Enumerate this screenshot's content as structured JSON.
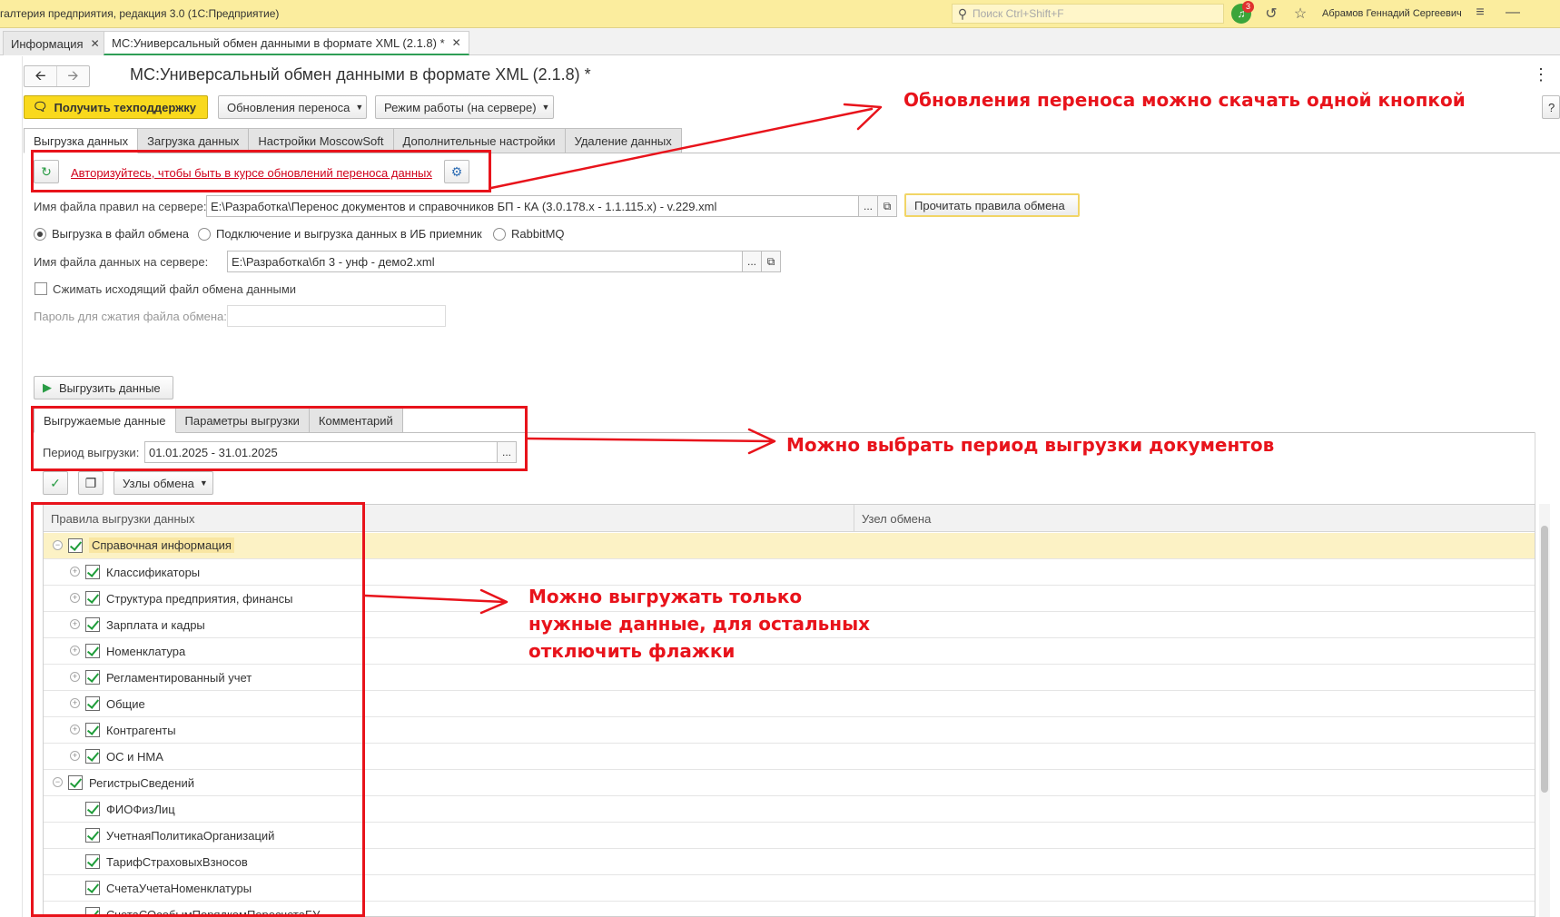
{
  "titlebar": {
    "app_title": "галтерия предприятия, редакция 3.0  (1С:Предприятие)",
    "search_placeholder": "Поиск Ctrl+Shift+F",
    "notifications_count": "3",
    "user_name": "Абрамов Геннадий Сергеевич"
  },
  "open_tabs": [
    {
      "label": "Информация"
    },
    {
      "label": "МС:Универсальный обмен данными в формате XML (2.1.8) *"
    }
  ],
  "form": {
    "title": "МС:Универсальный обмен данными в формате XML (2.1.8) *",
    "support_button": "Получить техподдержку",
    "updates_button": "Обновления переноса",
    "mode_button": "Режим работы (на сервере)",
    "help_button": "?",
    "tabs": [
      "Выгрузка данных",
      "Загрузка данных",
      "Настройки MoscowSoft",
      "Дополнительные настройки",
      "Удаление данных"
    ],
    "auth_link": "Авторизуйтесь, чтобы быть в курсе обновлений переноса данных",
    "rules_file_label": "Имя файла правил на сервере:",
    "rules_file_value": "E:\\Разработка\\Перенос документов и справочников БП - КА (3.0.178.x - 1.1.115.x) - v.229.xml",
    "read_rules_button": "Прочитать правила обмена",
    "radio_options": [
      "Выгрузка в файл обмена",
      "Подключение и выгрузка данных в ИБ приемник",
      "RabbitMQ"
    ],
    "data_file_label": "Имя файла данных на сервере:",
    "data_file_value": "E:\\Разработка\\бп 3 - унф - демо2.xml",
    "compress_label": "Сжимать исходящий файл обмена данными",
    "password_label": "Пароль для сжатия файла обмена:",
    "password_value": "",
    "export_button": "Выгрузить данные",
    "sub_tabs": [
      "Выгружаемые данные",
      "Параметры выгрузки",
      "Комментарий"
    ],
    "period_label": "Период выгрузки:",
    "period_value": "01.01.2025 - 31.01.2025",
    "nodes_button": "Узлы обмена",
    "ellipsis": "..."
  },
  "table": {
    "columns": [
      "Правила выгрузки данных",
      "Узел обмена"
    ],
    "rows": [
      {
        "label": "Справочная информация",
        "level": 0,
        "checked": true,
        "expander": "minus"
      },
      {
        "label": "Классификаторы",
        "level": 1,
        "checked": true,
        "expander": "plus"
      },
      {
        "label": "Структура предприятия, финансы",
        "level": 1,
        "checked": true,
        "expander": "plus"
      },
      {
        "label": "Зарплата и кадры",
        "level": 1,
        "checked": true,
        "expander": "plus"
      },
      {
        "label": "Номенклатура",
        "level": 1,
        "checked": true,
        "expander": "plus"
      },
      {
        "label": "Регламентированный учет",
        "level": 1,
        "checked": true,
        "expander": "plus"
      },
      {
        "label": "Общие",
        "level": 1,
        "checked": true,
        "expander": "plus"
      },
      {
        "label": "Контрагенты",
        "level": 1,
        "checked": true,
        "expander": "plus"
      },
      {
        "label": "ОС и НМА",
        "level": 1,
        "checked": true,
        "expander": "plus"
      },
      {
        "label": "РегистрыСведений",
        "level": 0,
        "checked": true,
        "expander": "minus"
      },
      {
        "label": "ФИОФизЛиц",
        "level": 1,
        "checked": true,
        "expander": "none"
      },
      {
        "label": "УчетнаяПолитикаОрганизаций",
        "level": 1,
        "checked": true,
        "expander": "none"
      },
      {
        "label": "ТарифСтраховыхВзносов",
        "level": 1,
        "checked": true,
        "expander": "none"
      },
      {
        "label": "СчетаУчетаНоменклатуры",
        "level": 1,
        "checked": true,
        "expander": "none"
      },
      {
        "label": "СчетаСОсобымПорядкомПересчетаБУ",
        "level": 1,
        "checked": true,
        "expander": "none"
      }
    ]
  },
  "annotations": {
    "note_updates": "Обновления переноса можно скачать одной кнопкой",
    "note_period": "Можно выбрать период выгрузки документов",
    "note_data_lines": [
      "Можно выгружать только",
      "нужные данные, для остальных",
      "отключить флажки"
    ]
  },
  "colors": {
    "titlebar_bg": "#fbed9e",
    "accent_yellow": "#f9d91d",
    "annotation_red": "#e8131b",
    "check_green": "#1f9d3a",
    "selected_row": "#fcf2c5"
  }
}
